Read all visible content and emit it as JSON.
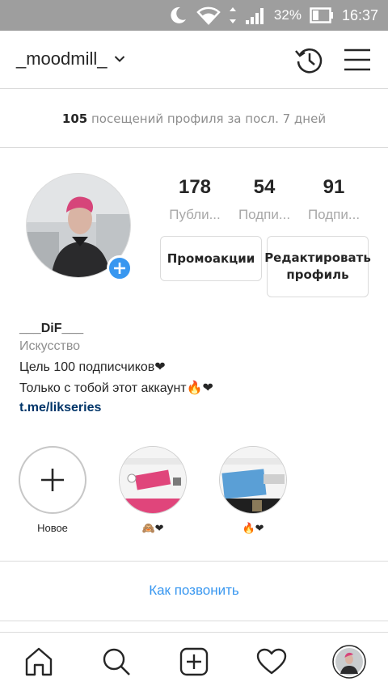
{
  "status_bar": {
    "battery": "32%",
    "time": "16:37",
    "icons": [
      "moon-icon",
      "wifi-icon",
      "signal-icon",
      "battery-icon"
    ]
  },
  "header": {
    "username": "_moodmill_",
    "icons": [
      "chevron-down-icon",
      "history-icon",
      "menu-icon"
    ]
  },
  "visits": {
    "count": "105",
    "text": "посещений профиля за посл. 7 дней"
  },
  "profile": {
    "stats": [
      {
        "value": "178",
        "label": "Публи..."
      },
      {
        "value": "54",
        "label": "Подпи..."
      },
      {
        "value": "91",
        "label": "Подпи..."
      }
    ],
    "promo_button": "Промоакции",
    "edit_button": "Редактировать профиль",
    "bio": {
      "name": "___DiF___",
      "category": "Искусство",
      "line1": "Цель 100 подписчиков❤",
      "line2": "Только с тобой этот аккаунт🔥❤",
      "link": "t.me/likseries"
    }
  },
  "highlights": [
    {
      "label": "Новое"
    },
    {
      "label": "🙈❤"
    },
    {
      "label": "🔥❤"
    }
  ],
  "call_link": "Как позвонить",
  "colors": {
    "accent": "#3897f0",
    "link": "#003569",
    "status_bar": "#9e9e9e",
    "muted": "#8e8e8e"
  }
}
